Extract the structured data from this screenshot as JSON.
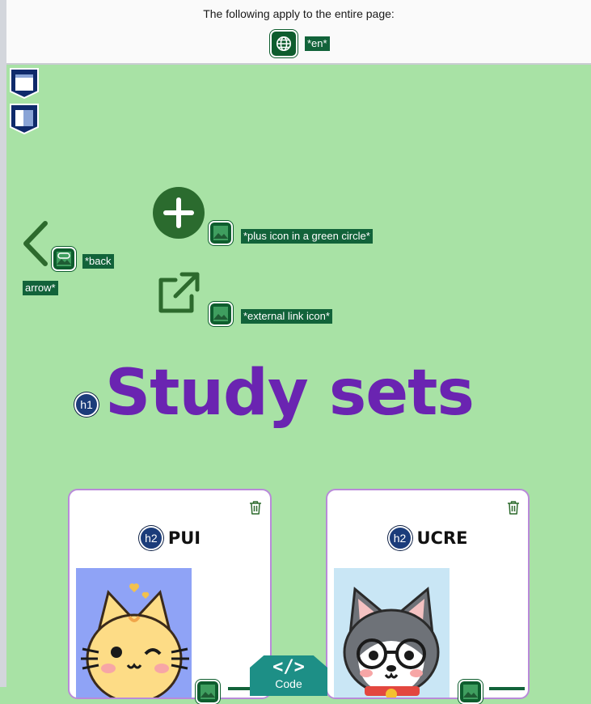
{
  "header": {
    "title": "The following apply to the entire page:",
    "language_tag": "*en*"
  },
  "icons": {
    "back": {
      "icon": "back-arrow-icon",
      "alt": "*back arrow*"
    },
    "plus": {
      "icon": "plus-icon",
      "alt": "*plus icon in a green circle*"
    },
    "external": {
      "icon": "external-link-icon",
      "alt": "*external link icon*"
    }
  },
  "page": {
    "heading_level": "h1",
    "title": "Study sets"
  },
  "cards": [
    {
      "heading_level": "h2",
      "title": "PUI",
      "image": "cat-avatar"
    },
    {
      "heading_level": "h2",
      "title": "UCRE",
      "image": "husky-avatar"
    }
  ],
  "code_badge": {
    "glyph": "</>",
    "label": "Code"
  },
  "colors": {
    "background": "#a8e2a5",
    "accent_green": "#0e5d2e",
    "title_purple": "#6a24b1",
    "heading_badge": "#1b3c7a",
    "card_border": "#b98ad9",
    "code_teal": "#1d8f86"
  }
}
